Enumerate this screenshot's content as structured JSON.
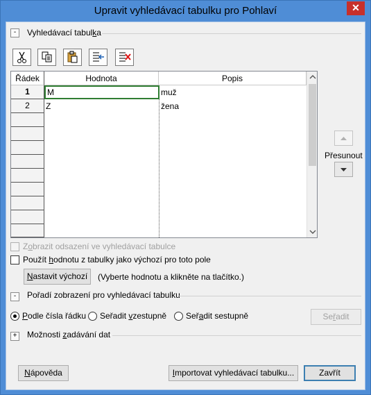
{
  "window": {
    "title": "Upravit vyhledávací tabulku pro Pohlaví",
    "close_glyph": "✕"
  },
  "section_lookup": {
    "toggle": "-",
    "label_pre": "Vyhledávací tabul",
    "label_key": "k",
    "label_post": "a"
  },
  "toolbar": {
    "cut": "cut-icon",
    "copy": "copy-icon",
    "paste": "paste-icon",
    "insert_row": "insert-row-icon",
    "delete_row": "delete-row-icon"
  },
  "grid": {
    "columns": [
      "Řádek",
      "Hodnota",
      "Popis"
    ],
    "rows": [
      {
        "num": "1",
        "value": "M",
        "desc": "muž"
      },
      {
        "num": "2",
        "value": "Z",
        "desc": "žena"
      }
    ],
    "empty_row_count": 8
  },
  "move": {
    "label": "Přesunout"
  },
  "options": {
    "show_indent": {
      "pre": "Z",
      "key": "o",
      "post": "brazit odsazení ve vyhledávací tabulce",
      "checked": false,
      "enabled": false
    },
    "use_default": {
      "pre": "Použít ",
      "key": "h",
      "post": "odnotu z tabulky jako výchozí pro toto pole",
      "checked": false
    },
    "set_default_button": {
      "pre": "",
      "key": "N",
      "post": "astavit výchozí"
    },
    "hint": "(Vyberte hodnotu a klikněte na tlačítko.)"
  },
  "section_order": {
    "toggle": "-",
    "label_pre": "Pořadí zobrazení pro vyhledávací tabulku",
    "radios": [
      {
        "pre": "",
        "key": "P",
        "post": "odle čísla řádku",
        "selected": true
      },
      {
        "pre": "Seřadit ",
        "key": "v",
        "post": "zestupně",
        "selected": false
      },
      {
        "pre": "Seř",
        "key": "a",
        "post": "dit sestupně",
        "selected": false
      }
    ],
    "sort_button": {
      "pre": "Se",
      "key": "ř",
      "post": "adit"
    }
  },
  "section_input": {
    "toggle": "+",
    "label_pre": "Možnosti ",
    "label_key": "z",
    "label_post": "adávání dat"
  },
  "footer": {
    "help": {
      "pre": "",
      "key": "N",
      "post": "ápověda"
    },
    "import": {
      "pre": "",
      "key": "I",
      "post": "mportovat vyhledávací tabulku..."
    },
    "close": "Zavřít"
  }
}
